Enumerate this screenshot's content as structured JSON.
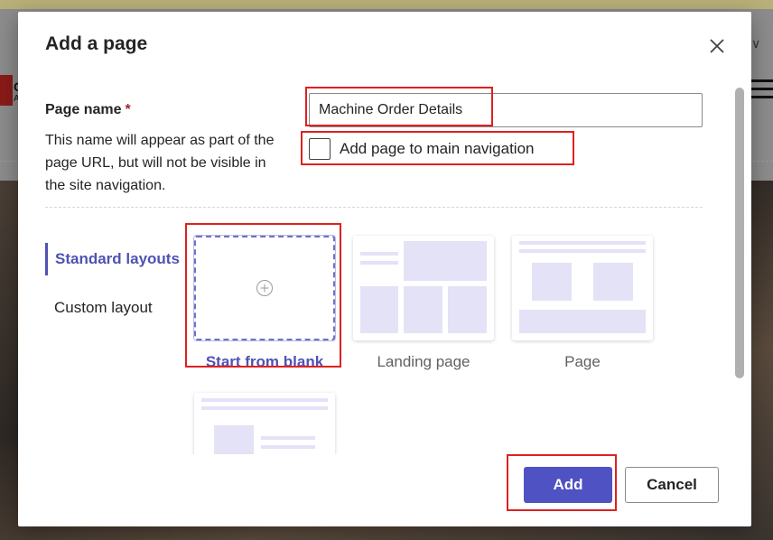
{
  "background": {
    "logo_letter": "C",
    "logo_sub": "A"
  },
  "dialog": {
    "title": "Add a page",
    "page_name": {
      "label": "Page name",
      "required_marker": "*",
      "description": "This name will appear as part of the page URL, but will not be visible in the site navigation.",
      "value": "Machine Order Details"
    },
    "main_nav_checkbox": {
      "label": "Add page to main navigation",
      "checked": false
    },
    "layout_tabs": [
      {
        "label": "Standard layouts",
        "active": true
      },
      {
        "label": "Custom layout",
        "active": false
      }
    ],
    "templates": [
      {
        "label": "Start from blank",
        "selected": true
      },
      {
        "label": "Landing page",
        "selected": false
      },
      {
        "label": "Page",
        "selected": false
      },
      {
        "label": "",
        "selected": false
      }
    ],
    "buttons": {
      "add": "Add",
      "cancel": "Cancel"
    }
  },
  "colors": {
    "accent": "#4f52c2",
    "annotation": "#e02020",
    "placeholder_block": "#e4e2f7"
  },
  "icons": {
    "close": "close-icon",
    "plus": "plus-circle-icon",
    "chevron": "chevron-down-icon",
    "menu": "hamburger-icon"
  }
}
